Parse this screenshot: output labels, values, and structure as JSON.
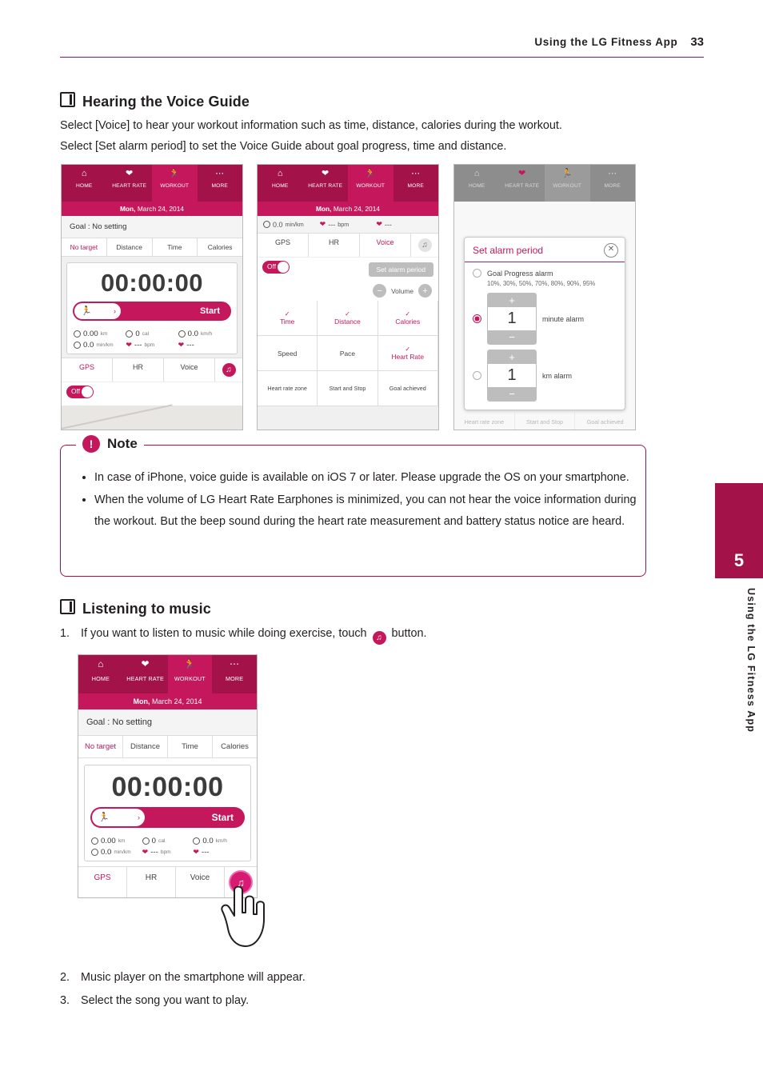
{
  "header": {
    "title": "Using the LG Fitness App",
    "page": "33"
  },
  "side_tab": {
    "number": "5",
    "vertical_text": "Using the LG Fitness App"
  },
  "sections": {
    "voice_guide": {
      "heading": "Hearing the Voice Guide",
      "line1": "Select [Voice] to hear your workout information such as time, distance, calories during the workout.",
      "line2": "Select [Set alarm period] to set the Voice Guide about goal progress, time and distance."
    },
    "music": {
      "heading": "Listening to music",
      "step1_num": "1.",
      "step1_a": "If you want to listen to music while doing exercise, touch",
      "step1_b": "button.",
      "step2_num": "2.",
      "step2": "Music player on the smartphone will appear.",
      "step3_num": "3.",
      "step3": "Select the song you want to play."
    }
  },
  "note": {
    "title": "Note",
    "items": [
      "In case of iPhone, voice guide is available on iOS 7 or later. Please upgrade the OS on your smartphone.",
      "When the volume of LG Heart Rate Earphones is minimized, you can not hear the voice information during the workout. But the beep sound during the heart rate measurement and battery status notice are heard."
    ]
  },
  "phone_common": {
    "nav": [
      {
        "label": "HOME",
        "icon": "home-icon",
        "glyph": "⌂"
      },
      {
        "label": "HEART RATE",
        "icon": "heart-icon",
        "glyph": "♥"
      },
      {
        "label": "WORKOUT",
        "icon": "runner-icon",
        "glyph": "Ἴ3"
      },
      {
        "label": "MORE",
        "icon": "more-icon",
        "glyph": "•••"
      }
    ],
    "date_prefix": "Mon,",
    "date_rest": " March 24, 2014",
    "goal": "Goal : No setting",
    "tabs": [
      "No target",
      "Distance",
      "Time",
      "Calories"
    ],
    "timer": "00:00:00",
    "start": "Start",
    "stats": {
      "distance": "0.00",
      "distance_unit": "km",
      "calories": "0",
      "calories_unit": "cal",
      "speed": "0.0",
      "speed_unit": "km/h",
      "pace": "0.0",
      "pace_unit": "min/km",
      "hr_dash": "---",
      "hr_unit": "bpm",
      "hr2_dash": "---"
    },
    "buttons": [
      "GPS",
      "HR",
      "Voice"
    ],
    "off": "Off"
  },
  "phone2": {
    "mini_pace": "0.0",
    "mini_pace_unit": "min/km",
    "mini_hr": "---",
    "mini_hr_unit": "bpm",
    "mini_hr2": "---",
    "set_alarm_period": "Set alarm period",
    "volume": "Volume",
    "volume_minus": "−",
    "volume_plus": "+",
    "grid": [
      {
        "label": "Time",
        "on": true
      },
      {
        "label": "Distance",
        "on": true
      },
      {
        "label": "Calories",
        "on": true
      },
      {
        "label": "Speed",
        "on": false
      },
      {
        "label": "Pace",
        "on": false
      },
      {
        "label": "Heart Rate",
        "on": true
      },
      {
        "label": "Heart rate zone",
        "on": false
      },
      {
        "label": "Start and Stop",
        "on": false
      },
      {
        "label": "Goal achieved",
        "on": false
      }
    ]
  },
  "phone3": {
    "dialog_title": "Set alarm period",
    "goal_progress_alarm": "Goal Progress alarm",
    "goal_progress_values": "10%, 30%, 50%, 70%, 80%, 90%, 95%",
    "minute_value": "1",
    "minute_label": "minute alarm",
    "km_value": "1",
    "km_label": "km alarm",
    "plus": "+",
    "minus": "−",
    "bottom_row": [
      "Heart rate zone",
      "Start and Stop",
      "Goal achieved"
    ]
  }
}
